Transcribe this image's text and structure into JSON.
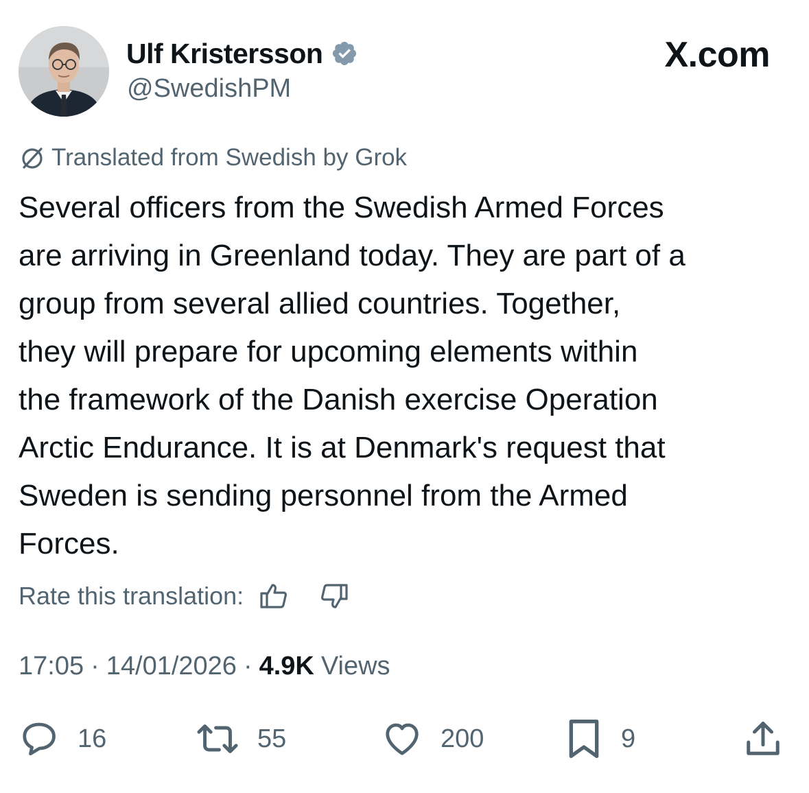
{
  "author": {
    "name": "Ulf Kristersson",
    "handle": "@SwedishPM",
    "verified": true,
    "verified_color": "#829aab"
  },
  "brand": "X.com",
  "translation_note": "Translated from Swedish by Grok",
  "body": "Several officers from the Swedish Armed Forces\nare arriving in Greenland today. They are part of a\ngroup from several allied countries. Together,\nthey will prepare for upcoming elements within\nthe framework of the Danish exercise Operation\nArctic Endurance. It is at Denmark's request that\nSweden is sending personnel from the Armed\nForces.",
  "rate_label": "Rate this translation:",
  "meta": {
    "time": "17:05",
    "separator": "·",
    "date": "14/01/2026",
    "views_count": "4.9K",
    "views_label": "Views"
  },
  "actions": {
    "replies": "16",
    "reposts": "55",
    "likes": "200",
    "bookmarks": "9"
  },
  "icons": {
    "avatar": "avatar",
    "verified": "verified-badge-icon",
    "grok": "grok-icon",
    "thumbs_up": "thumbs-up-icon",
    "thumbs_down": "thumbs-down-icon",
    "reply": "reply-icon",
    "repost": "repost-icon",
    "like": "heart-icon",
    "bookmark": "bookmark-icon",
    "share": "share-icon"
  },
  "colors": {
    "text_primary": "#0f1419",
    "text_secondary": "#536471",
    "background": "#ffffff"
  }
}
